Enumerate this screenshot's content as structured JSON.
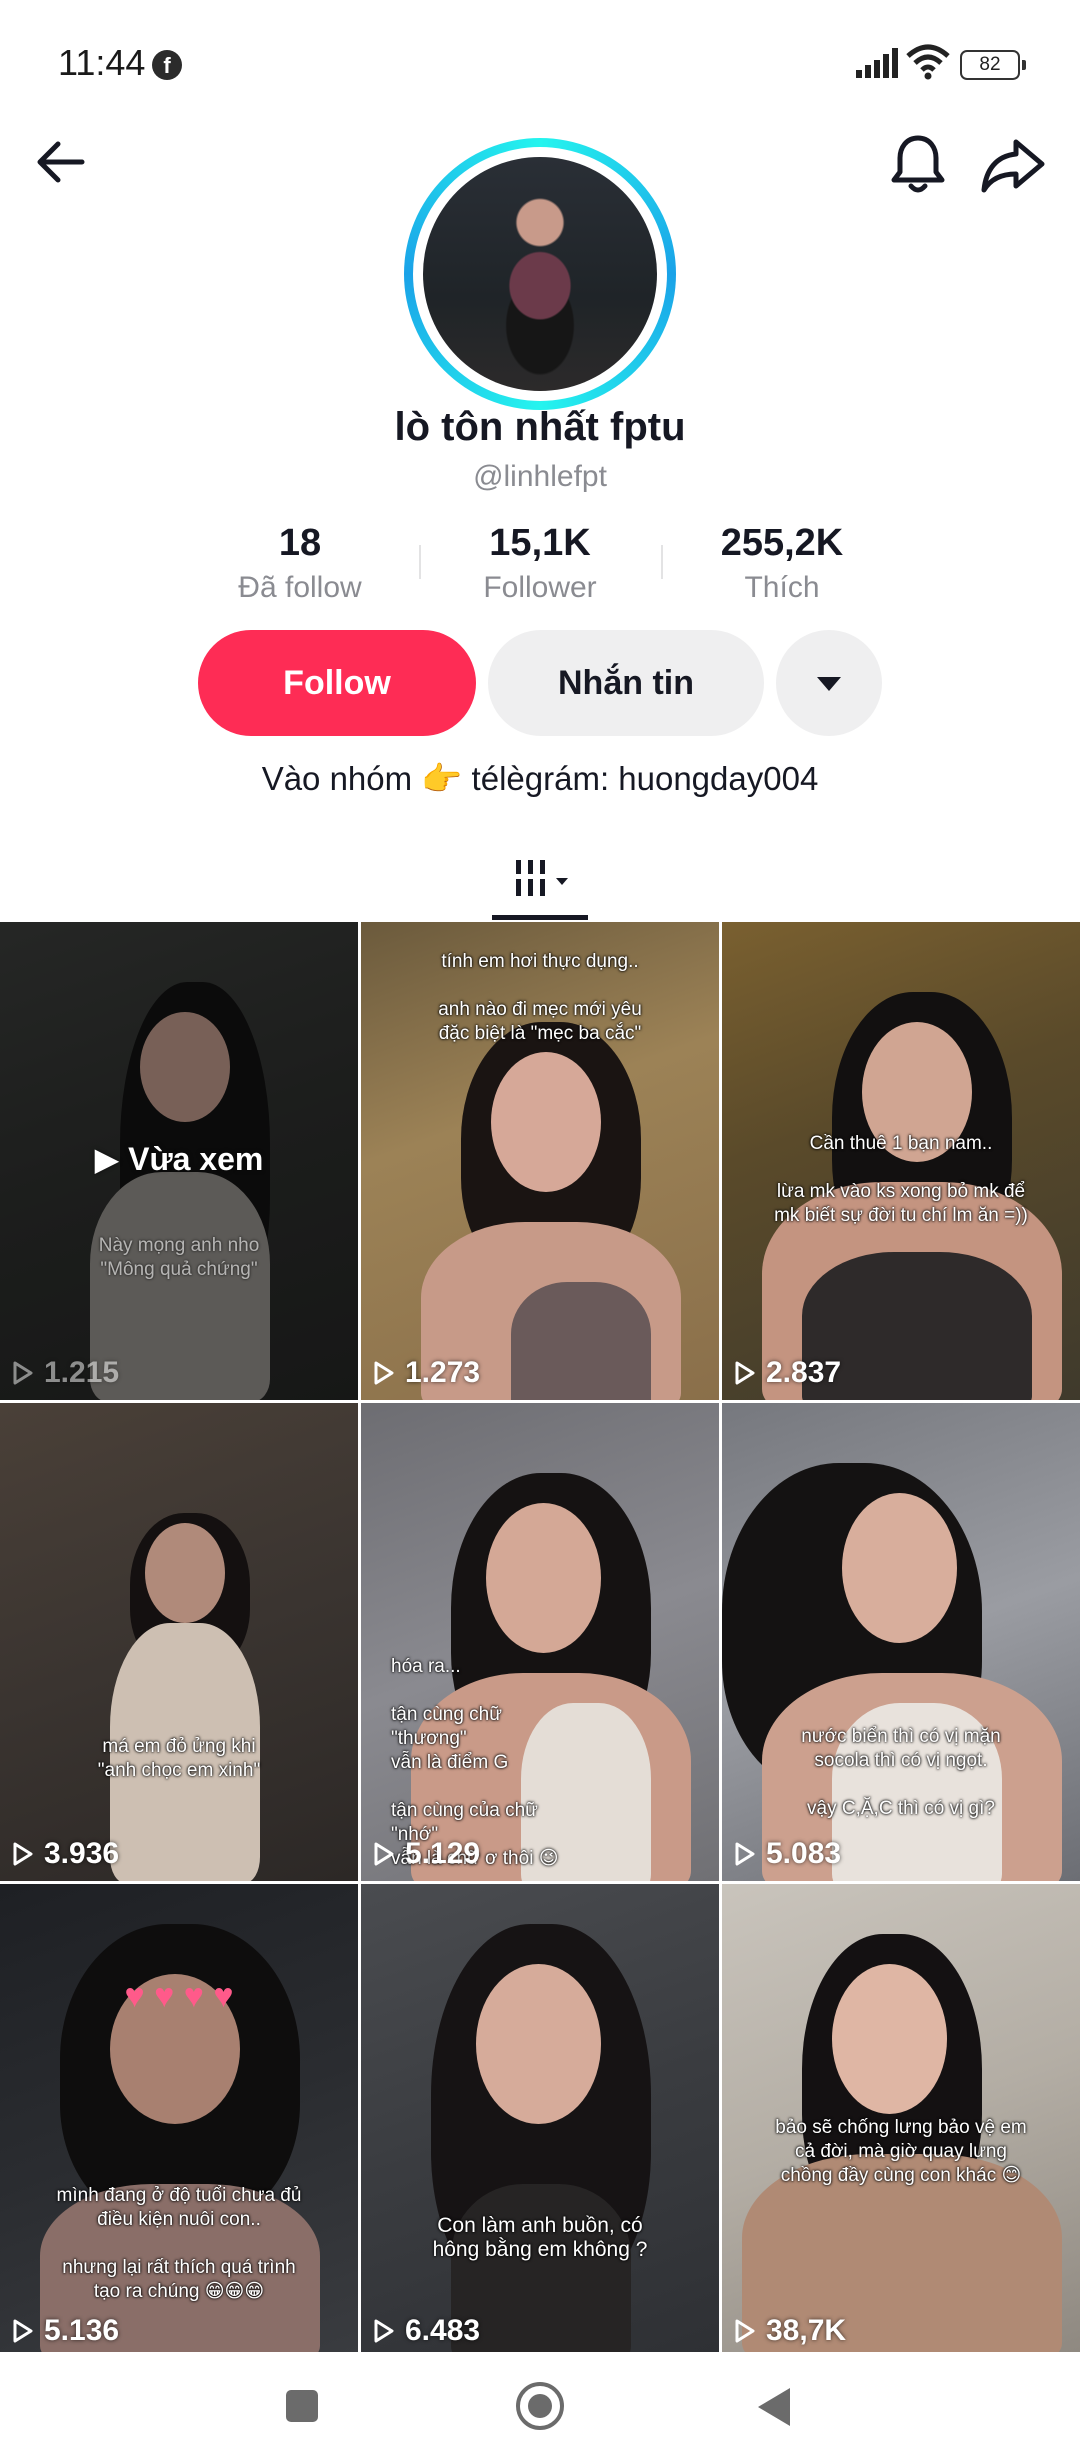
{
  "status_bar": {
    "time": "11:44",
    "battery": "82"
  },
  "profile": {
    "display_name": "lò tôn nhất fptu",
    "username": "@linhlefpt",
    "bio": "Vào nhóm 👉 télègrám: huongday004"
  },
  "stats": [
    {
      "value": "18",
      "label": "Đã follow"
    },
    {
      "value": "15,1K",
      "label": "Follower"
    },
    {
      "value": "255,2K",
      "label": "Thích"
    }
  ],
  "actions": {
    "follow": "Follow",
    "message": "Nhắn tin"
  },
  "icons": {
    "back": "back-arrow-icon",
    "bell": "bell-icon",
    "share": "share-icon",
    "facebook": "facebook-icon",
    "signal": "signal-icon",
    "wifi": "wifi-icon",
    "grid": "grid-icon",
    "play": "play-icon"
  },
  "colors": {
    "follow": "#fe2c55",
    "avatar_ring": "#25f4ee",
    "secondary_button": "#efeff0"
  },
  "videos": [
    {
      "views": "1.215",
      "watched_label": "Vừa xem",
      "caption": "Này mọng anh nho\n\"Mông quả chứng\""
    },
    {
      "views": "1.273",
      "caption": "tính em hơi thực dụng..\n\nanh nào đi mẹc mới yêu\nđặc biệt là \"mẹc ba cắc\""
    },
    {
      "views": "2.837",
      "caption": "Cần thuê 1 bạn nam..\n\nlừa mk vào ks xong bỏ mk để\nmk biết sự đời tu chí lm ăn =))"
    },
    {
      "views": "3.936",
      "caption": "má em đỏ ửng khi\n\"anh chọc em xinh\""
    },
    {
      "views": "5.129",
      "caption": "hóa ra...\n\ntận cùng chữ\n\"thương\"\nvẫn là điểm G\n\ntận cùng của chữ\n\"nhớ\"\nvẫn là chữ ơ thôi 😉"
    },
    {
      "views": "5.083",
      "caption": "nước biển thì có vị mặn\nsocola thì có vị ngọt.\n\nvậy C,Ặ,C thì có vị gì?"
    },
    {
      "views": "5.136",
      "caption": "mình đang ở độ tuổi chưa đủ\nđiều kiện nuôi con..\n\nnhưng lại rất thích quá trình\ntạo ra chúng 😁😁😁"
    },
    {
      "views": "6.483",
      "caption": "Con làm anh buồn, có\nhông bằng em không ?"
    },
    {
      "views": "38,7K",
      "caption": "bảo sẽ chống lưng bảo vệ em\ncả đời, mà giờ quay lưng\nchồng đầy cùng con khác 😊"
    }
  ]
}
